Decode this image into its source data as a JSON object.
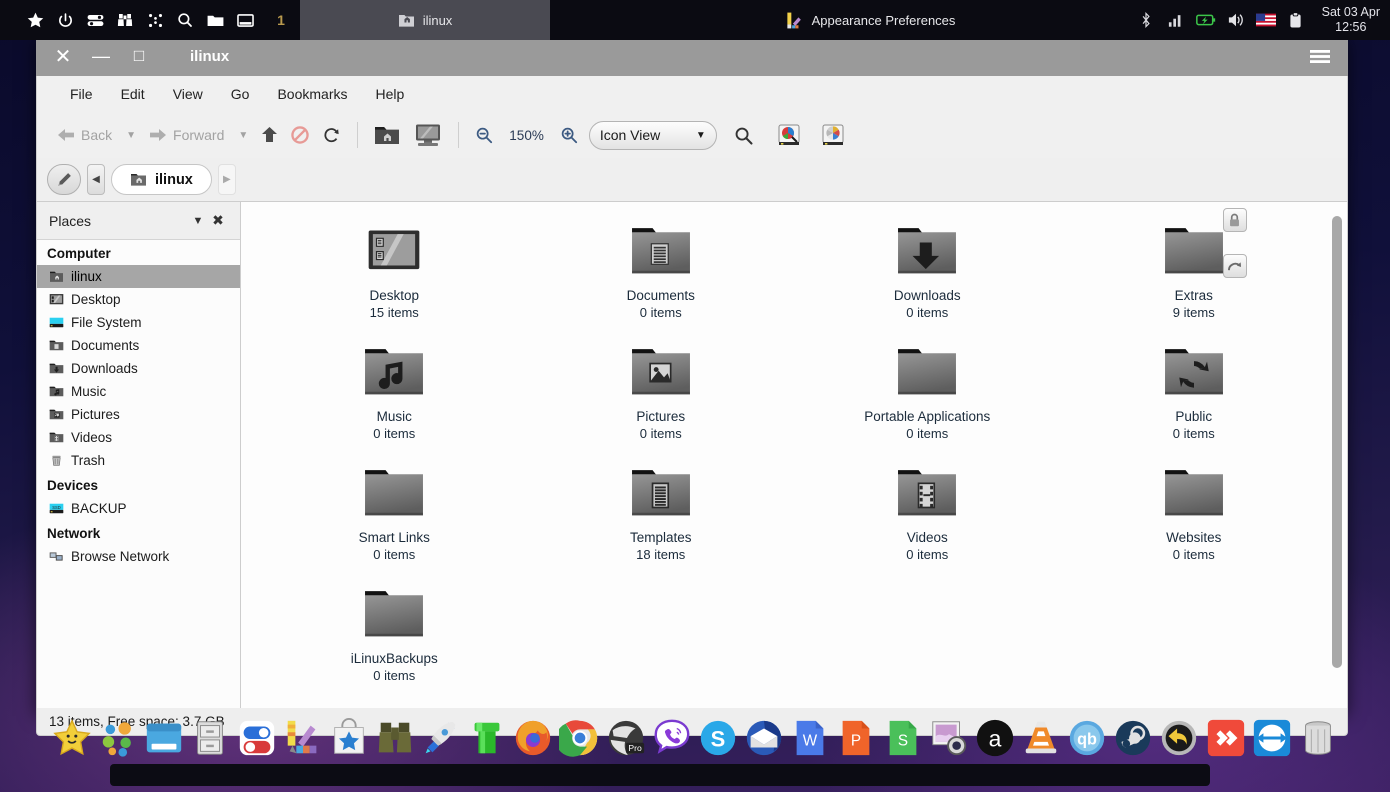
{
  "top_panel": {
    "launchers": [
      {
        "name": "star-icon",
        "label": "Favorites"
      },
      {
        "name": "power-icon",
        "label": "Power"
      },
      {
        "name": "settings-icon",
        "label": "Settings"
      },
      {
        "name": "binoculars-icon",
        "label": "Find"
      },
      {
        "name": "grid-dots-icon",
        "label": "Applications"
      },
      {
        "name": "search-icon",
        "label": "Search"
      },
      {
        "name": "folder-icon",
        "label": "File Manager"
      },
      {
        "name": "window-icon",
        "label": "Show Desktop"
      }
    ],
    "desktop_number": "1",
    "tasks": [
      {
        "label": "ilinux",
        "icon": "home-folder-icon",
        "active": true
      },
      {
        "label": "Appearance Preferences",
        "icon": "appearance-icon",
        "active": false
      }
    ],
    "tray": [
      "bluetooth-icon",
      "signal-icon",
      "battery-icon",
      "volume-icon",
      "flag-icon",
      "clipboard-icon"
    ],
    "clock_date": "Sat 03 Apr",
    "clock_time": "12:56"
  },
  "window": {
    "title": "ilinux",
    "controls": {
      "close": "✕",
      "minimize": "—",
      "maximize": "□"
    },
    "menubar": [
      "File",
      "Edit",
      "View",
      "Go",
      "Bookmarks",
      "Help"
    ],
    "toolbar": {
      "back": "Back",
      "forward": "Forward",
      "up_label": "Open Parent",
      "stop_label": "Stop",
      "reload_label": "Reload",
      "home_label": "Home Folder",
      "computer_label": "Computer",
      "zoom_out_label": "Zoom Out",
      "zoom_value": "150%",
      "zoom_in_label": "Zoom In",
      "view_mode": "Icon View",
      "search_label": "Search",
      "preview_label": "Preview",
      "color_label": "Appearance"
    },
    "path": {
      "edit_label": "Edit Path",
      "prev_label": "Previous",
      "next_label": "Next",
      "crumb": "ilinux"
    },
    "sidebar": {
      "header": "Places",
      "groups": [
        {
          "title": "Computer",
          "items": [
            {
              "label": "ilinux",
              "icon": "home-folder-icon",
              "selected": true
            },
            {
              "label": "Desktop",
              "icon": "desktop-icon",
              "selected": false
            },
            {
              "label": "File System",
              "icon": "drive-icon",
              "selected": false
            },
            {
              "label": "Documents",
              "icon": "documents-folder-icon",
              "selected": false
            },
            {
              "label": "Downloads",
              "icon": "downloads-folder-icon",
              "selected": false
            },
            {
              "label": "Music",
              "icon": "music-folder-icon",
              "selected": false
            },
            {
              "label": "Pictures",
              "icon": "pictures-folder-icon",
              "selected": false
            },
            {
              "label": "Videos",
              "icon": "videos-folder-icon",
              "selected": false
            },
            {
              "label": "Trash",
              "icon": "trash-icon",
              "selected": false
            }
          ]
        },
        {
          "title": "Devices",
          "items": [
            {
              "label": "BACKUP",
              "icon": "ssd-icon",
              "selected": false
            }
          ]
        },
        {
          "title": "Network",
          "items": [
            {
              "label": "Browse Network",
              "icon": "network-icon",
              "selected": false
            }
          ]
        }
      ]
    },
    "files": [
      {
        "name": "Desktop",
        "sub": "15 items",
        "icon": "desktop-icon",
        "badges": []
      },
      {
        "name": "Documents",
        "sub": "0 items",
        "icon": "documents-folder-icon",
        "badges": []
      },
      {
        "name": "Downloads",
        "sub": "0 items",
        "icon": "downloads-folder-icon",
        "badges": []
      },
      {
        "name": "Extras",
        "sub": "9 items",
        "icon": "plain-folder-icon",
        "badges": [
          "lock-badge-icon",
          "symlink-badge-icon"
        ]
      },
      {
        "name": "Music",
        "sub": "0 items",
        "icon": "music-folder-icon",
        "badges": []
      },
      {
        "name": "Pictures",
        "sub": "0 items",
        "icon": "pictures-folder-icon",
        "badges": []
      },
      {
        "name": "Portable Applications",
        "sub": "0 items",
        "icon": "plain-folder-icon",
        "badges": []
      },
      {
        "name": "Public",
        "sub": "0 items",
        "icon": "public-folder-icon",
        "badges": []
      },
      {
        "name": "Smart Links",
        "sub": "0 items",
        "icon": "plain-folder-icon",
        "badges": []
      },
      {
        "name": "Templates",
        "sub": "18 items",
        "icon": "templates-folder-icon",
        "badges": []
      },
      {
        "name": "Videos",
        "sub": "0 items",
        "icon": "videos-folder-icon",
        "badges": []
      },
      {
        "name": "Websites",
        "sub": "0 items",
        "icon": "plain-folder-icon",
        "badges": []
      },
      {
        "name": "iLinuxBackups",
        "sub": "0 items",
        "icon": "plain-folder-icon",
        "badges": []
      }
    ],
    "statusbar": "13 items, Free space: 3.7 GB"
  },
  "dock": {
    "items": [
      {
        "name": "star-launcher",
        "label": "Menu"
      },
      {
        "name": "dots-launcher",
        "label": "Applications"
      },
      {
        "name": "window-launcher",
        "label": "Desktop"
      },
      {
        "name": "file-cabinet-launcher",
        "label": "Files"
      },
      {
        "name": "toggles-launcher",
        "label": "Settings"
      },
      {
        "name": "palette-launcher",
        "label": "Appearance"
      },
      {
        "name": "store-launcher",
        "label": "Software Store"
      },
      {
        "name": "binoculars-launcher",
        "label": "Search"
      },
      {
        "name": "rocket-launcher",
        "label": "Launcher"
      },
      {
        "name": "pipe-launcher",
        "label": "Terminal"
      },
      {
        "name": "firefox-launcher",
        "label": "Firefox"
      },
      {
        "name": "chrome-launcher",
        "label": "Chrome"
      },
      {
        "name": "opera-launcher",
        "label": "Opera Pro"
      },
      {
        "name": "viber-launcher",
        "label": "Viber"
      },
      {
        "name": "skype-launcher",
        "label": "Skype"
      },
      {
        "name": "thunderbird-launcher",
        "label": "Thunderbird"
      },
      {
        "name": "writer-launcher",
        "label": "Writer"
      },
      {
        "name": "presentation-launcher",
        "label": "Presentation"
      },
      {
        "name": "spreadsheet-launcher",
        "label": "Spreadsheet"
      },
      {
        "name": "screenshot-launcher",
        "label": "Screenshot"
      },
      {
        "name": "amazon-launcher",
        "label": "Amazon"
      },
      {
        "name": "vlc-launcher",
        "label": "VLC"
      },
      {
        "name": "qbittorrent-launcher",
        "label": "qBittorrent"
      },
      {
        "name": "steam-launcher",
        "label": "Steam"
      },
      {
        "name": "restore-launcher",
        "label": "Restore"
      },
      {
        "name": "anydesk-launcher",
        "label": "AnyDesk"
      },
      {
        "name": "teamviewer-launcher",
        "label": "TeamViewer"
      },
      {
        "name": "trash-launcher",
        "label": "Trash"
      }
    ]
  },
  "colors": {
    "panel": "#0b0b12",
    "titlebar": "#9a9a9a",
    "chrome": "#f0f0f0",
    "selection": "#a6a6a6",
    "text": "#1b2b3b"
  }
}
